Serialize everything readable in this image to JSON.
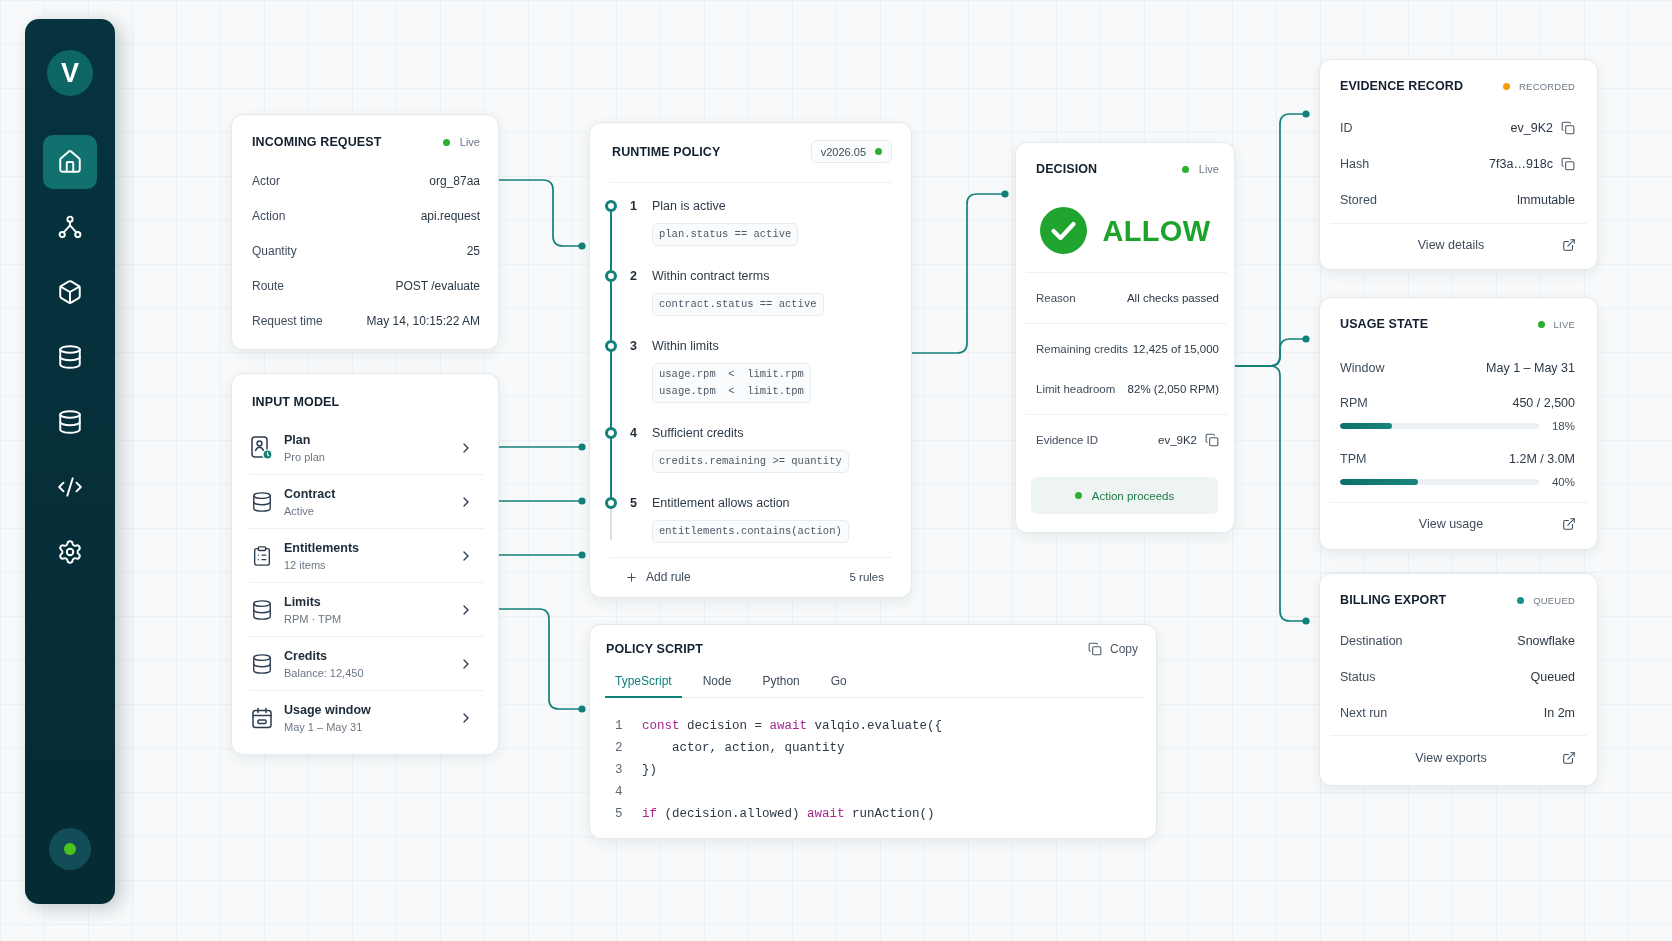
{
  "sidebar": {
    "logo": "V",
    "items": [
      {
        "kind": "home",
        "selected": true
      },
      {
        "kind": "network",
        "selected": false
      },
      {
        "kind": "cube",
        "selected": false
      },
      {
        "kind": "database",
        "selected": false
      },
      {
        "kind": "database",
        "selected": false
      },
      {
        "kind": "code",
        "selected": false
      },
      {
        "kind": "settings",
        "selected": false
      }
    ],
    "status_dot": {
      "color": "#4cc21c"
    }
  },
  "incoming_request": {
    "title": "INCOMING REQUEST",
    "status": {
      "label": "Live",
      "color": "#2bb02e"
    },
    "rows": [
      {
        "label": "Actor",
        "value": "org_87aa"
      },
      {
        "label": "Action",
        "value": "api.request"
      },
      {
        "label": "Quantity",
        "value": "25"
      },
      {
        "label": "Route",
        "value": "POST /evaluate"
      },
      {
        "label": "Request time",
        "value": "May 14, 10:15:22 AM"
      }
    ]
  },
  "input_model": {
    "title": "INPUT MODEL",
    "items": [
      {
        "kind": "plan",
        "title": "Plan",
        "subtitle": "Pro plan"
      },
      {
        "kind": "database",
        "title": "Contract",
        "subtitle": "Active"
      },
      {
        "kind": "clipboard",
        "title": "Entitlements",
        "subtitle": "12 items"
      },
      {
        "kind": "database",
        "title": "Limits",
        "subtitle": "RPM · TPM"
      },
      {
        "kind": "database",
        "title": "Credits",
        "subtitle": "Balance: 12,450"
      },
      {
        "kind": "calendar",
        "title": "Usage window",
        "subtitle": "May 1 – May 31"
      }
    ]
  },
  "runtime_policy": {
    "title": "RUNTIME POLICY",
    "version": {
      "label": "v2026.05",
      "color": "#2bb02e"
    },
    "rules": [
      {
        "number": "1",
        "title": "Plan is active",
        "code": [
          "plan.status == active"
        ]
      },
      {
        "number": "2",
        "title": "Within contract terms",
        "code": [
          "contract.status == active"
        ]
      },
      {
        "number": "3",
        "title": "Within limits",
        "code": [
          "usage.rpm  <  limit.rpm",
          "usage.tpm  <  limit.tpm"
        ]
      },
      {
        "number": "4",
        "title": "Sufficient credits",
        "code": [
          "credits.remaining >= quantity"
        ]
      },
      {
        "number": "5",
        "title": "Entitlement allows action",
        "code": [
          "entitlements.contains(action)"
        ]
      }
    ],
    "add_label": "Add rule",
    "count": "5 rules"
  },
  "policy_script": {
    "title": "POLICY SCRIPT",
    "copy_label": "Copy",
    "tabs": [
      {
        "label": "TypeScript",
        "selected": true
      },
      {
        "label": "Node",
        "selected": false
      },
      {
        "label": "Python",
        "selected": false
      },
      {
        "label": "Go",
        "selected": false
      }
    ],
    "lines": [
      {
        "number": "1",
        "tokens": [
          {
            "kind": "keyword",
            "text": "const"
          },
          {
            "kind": "plain",
            "text": " decision = "
          },
          {
            "kind": "keyword",
            "text": "await"
          },
          {
            "kind": "plain",
            "text": " valqio.evaluate({"
          }
        ]
      },
      {
        "number": "2",
        "tokens": [
          {
            "kind": "plain",
            "text": "    actor, action, quantity"
          }
        ]
      },
      {
        "number": "3",
        "tokens": [
          {
            "kind": "plain",
            "text": "})"
          }
        ]
      },
      {
        "number": "4"
      },
      {
        "number": "5",
        "tokens": [
          {
            "kind": "keyword",
            "text": "if"
          },
          {
            "kind": "plain",
            "text": " (decision.allowed) "
          },
          {
            "kind": "keyword",
            "text": "await"
          },
          {
            "kind": "plain",
            "text": " runAction()"
          }
        ]
      }
    ]
  },
  "decision": {
    "title": "DECISION",
    "status": {
      "label": "Live",
      "color": "#2bb02e"
    },
    "verdict": "ALLOW",
    "sections": [
      [
        {
          "label": "Reason",
          "value": "All checks passed",
          "copyable": false
        }
      ],
      [
        {
          "label": "Remaining credits",
          "value": "12,425 of 15,000",
          "copyable": false
        },
        {
          "label": "Limit headroom",
          "value": "82% (2,050 RPM)",
          "copyable": false
        }
      ],
      [
        {
          "label": "Evidence ID",
          "value": "ev_9K2",
          "copyable": true
        }
      ]
    ],
    "outcome": {
      "label": "Action proceeds",
      "color": "#2bb02e"
    }
  },
  "evidence_record": {
    "title": "EVIDENCE RECORD",
    "status": {
      "label": "RECORDED",
      "color": "#f39c12"
    },
    "rows": [
      {
        "label": "ID",
        "value": "ev_9K2",
        "copyable": true
      },
      {
        "label": "Hash",
        "value": "7f3a…918c",
        "copyable": true
      },
      {
        "label": "Stored",
        "value": "Immutable",
        "copyable": false
      }
    ],
    "link": "View details"
  },
  "usage_state": {
    "title": "USAGE STATE",
    "status": {
      "label": "LIVE",
      "color": "#2bb02e"
    },
    "rows": [
      {
        "kind": "text",
        "label": "Window",
        "value": "May 1 – May 31"
      },
      {
        "kind": "meter",
        "label": "RPM",
        "value": "450 / 2,500",
        "level": 0.26,
        "percent": "18%"
      },
      {
        "kind": "meter",
        "label": "TPM",
        "value": "1.2M / 3.0M",
        "level": 0.39,
        "percent": "40%"
      }
    ],
    "link": "View usage"
  },
  "billing_export": {
    "title": "BILLING EXPORT",
    "status": {
      "label": "QUEUED",
      "color": "#14938a"
    },
    "rows": [
      {
        "label": "Destination",
        "value": "Snowflake",
        "copyable": false
      },
      {
        "label": "Status",
        "value": "Queued",
        "copyable": false
      },
      {
        "label": "Next run",
        "value": "In 2m",
        "copyable": false
      }
    ],
    "link": "View exports"
  }
}
